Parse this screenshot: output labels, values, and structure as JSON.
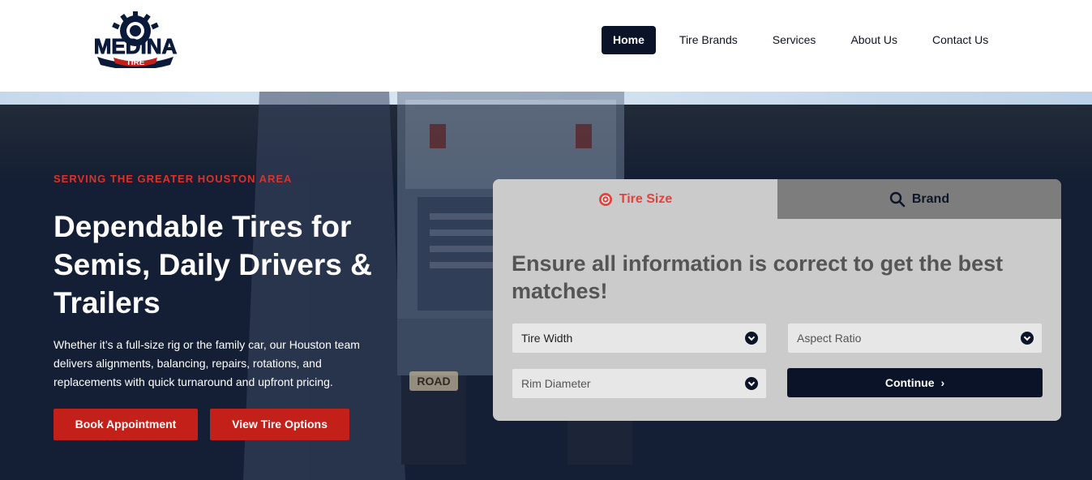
{
  "header": {
    "logo_text_top": "MEDINA",
    "logo_text_bottom": "TIRE",
    "nav": [
      {
        "label": "Home",
        "active": true
      },
      {
        "label": "Tire Brands",
        "active": false
      },
      {
        "label": "Services",
        "active": false
      },
      {
        "label": "About Us",
        "active": false
      },
      {
        "label": "Contact Us",
        "active": false
      }
    ]
  },
  "hero": {
    "eyebrow": "SERVING THE GREATER HOUSTON AREA",
    "headline": "Dependable Tires for Semis, Daily Drivers & Trailers",
    "body": "Whether it’s a full-size rig or the family car, our Houston team delivers alignments, balancing, repairs, rotations, and replacements with quick turnaround and upfront pricing.",
    "book_label": "Book Appointment",
    "view_label": "View Tire Options",
    "truck_sign": "ROAD"
  },
  "search": {
    "tab_size": "Tire Size",
    "tab_brand": "Brand",
    "title": "Ensure all information is correct to get the best matches!",
    "width_label": "Tire Width",
    "aspect_label": "Aspect Ratio",
    "rim_label": "Rim Diameter",
    "continue_label": "Continue"
  },
  "colors": {
    "navy": "#0a1328",
    "red": "#c4201a",
    "accent_red": "#e2433b",
    "panel_gray": "#cbcbcb"
  }
}
